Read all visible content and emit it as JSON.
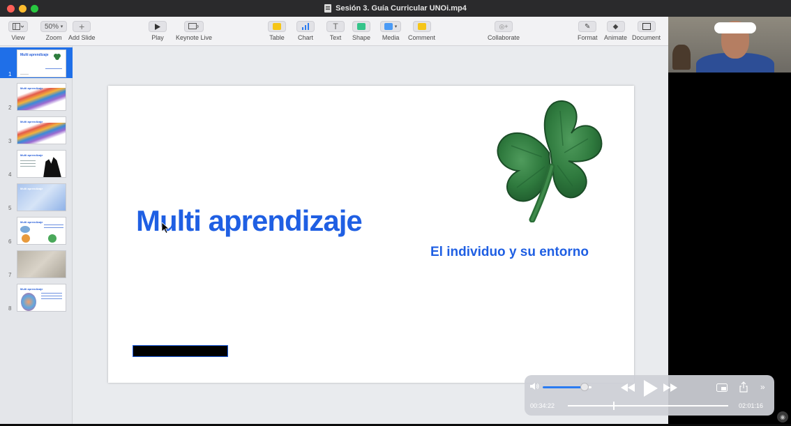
{
  "window": {
    "title": "Sesión 3. Guía Curricular UNOi.mp4",
    "traffic_colors": [
      "#ff5f57",
      "#febc2e",
      "#28c840"
    ]
  },
  "toolbar": {
    "view_label": "View",
    "zoom_value": "50%",
    "zoom_label": "Zoom",
    "add_slide_label": "Add Slide",
    "play_label": "Play",
    "keynote_live_label": "Keynote Live",
    "table_label": "Table",
    "chart_label": "Chart",
    "text_label": "Text",
    "shape_label": "Shape",
    "media_label": "Media",
    "comment_label": "Comment",
    "collaborate_label": "Collaborate",
    "format_label": "Format",
    "animate_label": "Animate",
    "document_label": "Document"
  },
  "navigator": {
    "slides": [
      {
        "number": "1",
        "selected": true
      },
      {
        "number": "2",
        "selected": false
      },
      {
        "number": "3",
        "selected": false
      },
      {
        "number": "4",
        "selected": false
      },
      {
        "number": "5",
        "selected": false
      },
      {
        "number": "6",
        "selected": false
      },
      {
        "number": "7",
        "selected": false
      },
      {
        "number": "8",
        "selected": false
      }
    ]
  },
  "slide": {
    "title": "Multi aprendizaje",
    "subtitle": "El individuo y su entorno",
    "accent_color": "#1f5fe3",
    "image": "shamrock-clover"
  },
  "player": {
    "elapsed": "00:34:22",
    "duration": "02:01:16",
    "progress_fraction": 0.283,
    "volume_fraction": 0.85
  },
  "icons": {
    "record": "record-icon",
    "rewind": "rewind-icon",
    "play": "play-icon",
    "forward": "fast-forward-icon",
    "pip": "picture-in-picture-icon",
    "share": "share-icon",
    "more": "more-icon"
  }
}
